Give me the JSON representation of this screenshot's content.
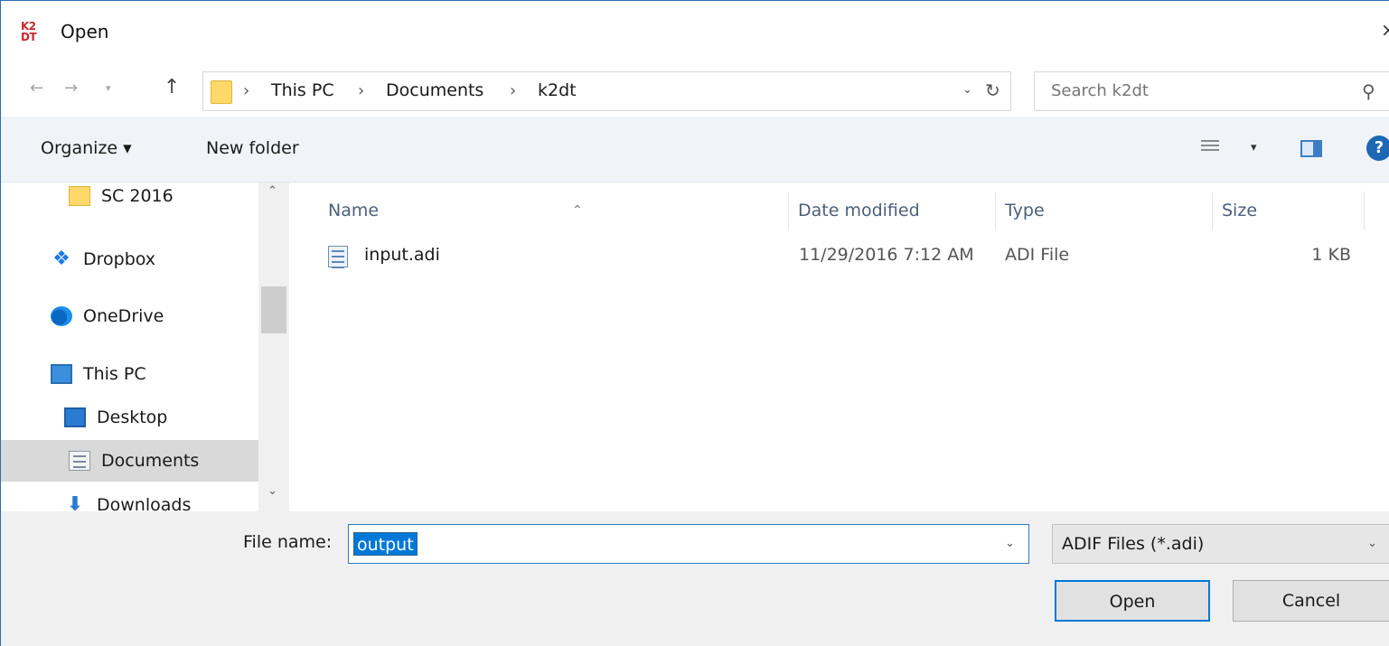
{
  "window": {
    "title": "Open",
    "logo_top": "K2",
    "logo_bottom": "DT",
    "close_glyph": "×"
  },
  "nav": {
    "back_glyph": "←",
    "forward_glyph": "→",
    "recent_glyph": "▾",
    "up_glyph": "↑"
  },
  "address": {
    "separator": "›",
    "crumbs": [
      "This PC",
      "Documents",
      "k2dt"
    ],
    "dropdown_glyph": "⌄",
    "refresh_glyph": "↻"
  },
  "search": {
    "placeholder": "Search k2dt",
    "icon_glyph": "⚲"
  },
  "toolbar": {
    "organize_label": "Organize ▾",
    "new_folder_label": "New folder",
    "view_dd_glyph": "▾",
    "help_glyph": "?"
  },
  "sidebar": {
    "items": [
      {
        "label": "SC 2016",
        "icon": "folder-icon"
      },
      {
        "label": "Dropbox",
        "icon": "dropbox-icon"
      },
      {
        "label": "OneDrive",
        "icon": "onedrive-icon"
      },
      {
        "label": "This PC",
        "icon": "computer-icon"
      },
      {
        "label": "Desktop",
        "icon": "desktop-icon"
      },
      {
        "label": "Documents",
        "icon": "documents-icon",
        "selected": true
      },
      {
        "label": "Downloads",
        "icon": "downloads-icon"
      }
    ],
    "scroll_up_glyph": "⌃",
    "scroll_down_glyph": "⌄"
  },
  "filelist": {
    "columns": [
      "Name",
      "Date modified",
      "Type",
      "Size"
    ],
    "sort_glyph": "⌃",
    "rows": [
      {
        "name": "input.adi",
        "date": "11/29/2016 7:12 AM",
        "type": "ADI File",
        "size": "1 KB"
      }
    ]
  },
  "footer": {
    "file_name_label": "File name:",
    "file_name_value": "output",
    "file_name_dd_glyph": "⌄",
    "file_type_value": "ADIF Files (*.adi)",
    "file_type_dd_glyph": "⌄",
    "open_label": "Open",
    "cancel_label": "Cancel"
  },
  "colors": {
    "accent": "#0078d7",
    "toolbar_bg": "#f0f4f9",
    "selected_bg": "#d9d9d9",
    "footer_bg": "#f0f0f0"
  }
}
